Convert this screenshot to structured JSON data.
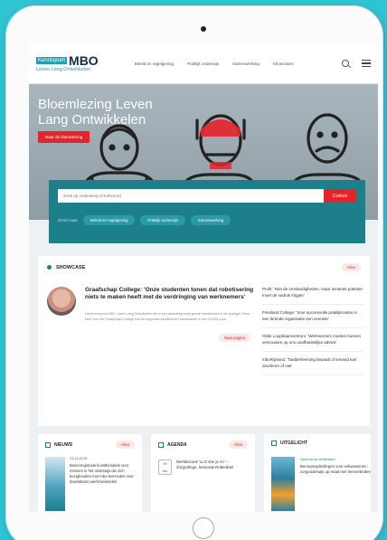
{
  "colors": {
    "background": "#2fc4d3",
    "accent_red": "#e3242b",
    "teal_dark": "#1c7f8a",
    "navy": "#1a2a4a"
  },
  "header": {
    "logo_small": "Kennispunt",
    "logo_mbo": "MBO",
    "logo_sub": "Leven Lang Ontwikkelen",
    "nav": [
      "Beleid en regelgeving",
      "Praktijk onderwijs",
      "Samenwerking",
      "Showcases"
    ]
  },
  "hero": {
    "title": "Bloemlezing Leven Lang Ontwikkelen",
    "button": "Naar de bloemlezing"
  },
  "search": {
    "placeholder": "Zoek op onderwerp of trefwoord",
    "button": "Zoeken",
    "filter_label": "Direct naar",
    "filters": [
      "Beleid en regelgeving",
      "Praktijk onderwijs",
      "Samenwerking"
    ]
  },
  "showcase": {
    "title": "SHOWCASE",
    "all_label": "Alles",
    "headline": "Graafschap College: 'Onze studenten tonen dat robotisering niets te maken heeft met de verdringing van werknemers'",
    "body": "Het Kennispunt MBO Leven Lang Ontwikkelen zet in een aanvulling extra goede voorbeelden in de spotlight. Deze keer: hoe het Graafschap College met het regionale bedrijfsleven samenwerkt in een CORDI-punt.",
    "read_more": "Naar pagina",
    "list": [
      "Profit: 'Niet de omstandigheden, maar iemands potentie moet de nadruk krijgen'",
      "Friesland College: 'Voor succesvolle praktijkroutes is een lerende organisatie een vereiste'",
      "Gilde Loopbaancentrum: 'Werknemers moeten kunnen vertrouwen op ons onafhankelijke advies'",
      "mboRijnland: 'Taalbeheersing bepaalt of iemand kan doorleren of niet'"
    ]
  },
  "nieuws": {
    "title": "NIEUWS",
    "all_label": "Alles",
    "date": "21-12-2019",
    "text": "Bovenregionale kunstkenaties voor mensen in het onderwijs die zich bezighouden met mbo-leerroutes voor (kwetsbare) werkzoekenden"
  },
  "agenda": {
    "title": "AGENDA",
    "all_label": "Alles",
    "date_day": "09",
    "date_month": "dec",
    "text": "Werkbezoek 'LLO doe je zo' – Zorgcollege, leducatie Rotterdam"
  },
  "uitgelicht": {
    "title": "UITGELICHT",
    "tag": "Diploma en certificaten",
    "text": "Beroepsopleidingen voor volwassenen: zorgonderwijs op maat met leerverbeden"
  }
}
